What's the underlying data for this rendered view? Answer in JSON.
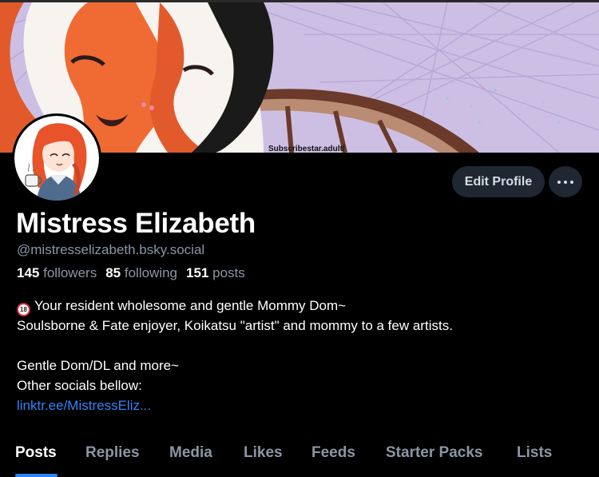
{
  "banner": {
    "watermark": "Subscribestar.adult/"
  },
  "profile": {
    "display_name": "Mistress Elizabeth",
    "handle": "@mistresselizabeth.bsky.social",
    "edit_label": "Edit Profile"
  },
  "stats": {
    "followers_count": "145",
    "followers_label": "followers",
    "following_count": "85",
    "following_label": "following",
    "posts_count": "151",
    "posts_label": "posts"
  },
  "bio": {
    "badge": "18",
    "line1": "Your resident wholesome and gentle Mommy Dom~",
    "line2": "Soulsborne & Fate enjoyer, Koikatsu \"artist\" and mommy to a few artists.",
    "line3": "Gentle Dom/DL and more~",
    "line4": "Other socials bellow:",
    "link": "linktr.ee/MistressEliz..."
  },
  "tabs": [
    {
      "label": "Posts",
      "active": true
    },
    {
      "label": "Replies"
    },
    {
      "label": "Media"
    },
    {
      "label": "Likes"
    },
    {
      "label": "Feeds"
    },
    {
      "label": "Starter Packs"
    },
    {
      "label": "Lists"
    }
  ],
  "colors": {
    "accent": "#2f84f5",
    "muted": "#8a96a5",
    "button_bg": "#1e2732"
  }
}
